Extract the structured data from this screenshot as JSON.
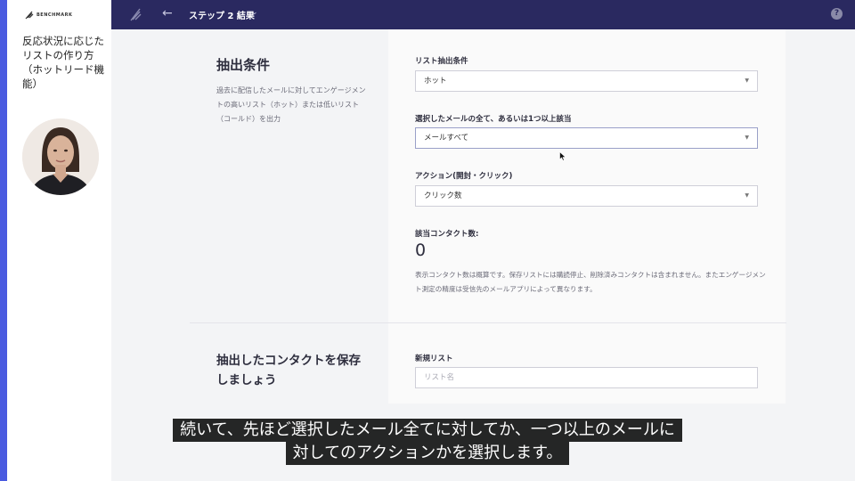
{
  "video": {
    "logo_text": "BENCHMARK",
    "lesson_title": "反応状況に応じたリストの作り方（ホットリード機能）"
  },
  "topbar": {
    "back_icon": "arrow-left-icon",
    "step_title": "ステップ 2  結果",
    "help_icon": "question-circle-icon"
  },
  "extraction": {
    "title": "抽出条件",
    "description": "過去に配信したメールに対してエンゲージメントの高いリスト（ホット）または低いリスト（コールド）を出力",
    "list_condition_label": "リスト抽出条件",
    "list_condition_value": "ホット",
    "mail_scope_label": "選択したメールの全て、あるいは1つ以上該当",
    "mail_scope_value": "メールすべて",
    "action_label": "アクション(開封・クリック)",
    "action_value": "クリック数",
    "contact_count_label": "該当コンタクト数:",
    "contact_count": "0",
    "note": "表示コンタクト数は概算です。保存リストには購読停止、削除済みコンタクトは含まれません。またエンゲージメント測定の精度は受信先のメールアプリによって異なります。"
  },
  "save": {
    "title": "抽出したコンタクトを保存しましょう",
    "new_list_label": "新規リスト",
    "list_name_placeholder": "リスト名"
  },
  "subtitles": {
    "line1": "続いて、先ほど選択したメール全てに対してか、一つ以上のメールに",
    "line2": "対してのアクションかを選択します。"
  }
}
